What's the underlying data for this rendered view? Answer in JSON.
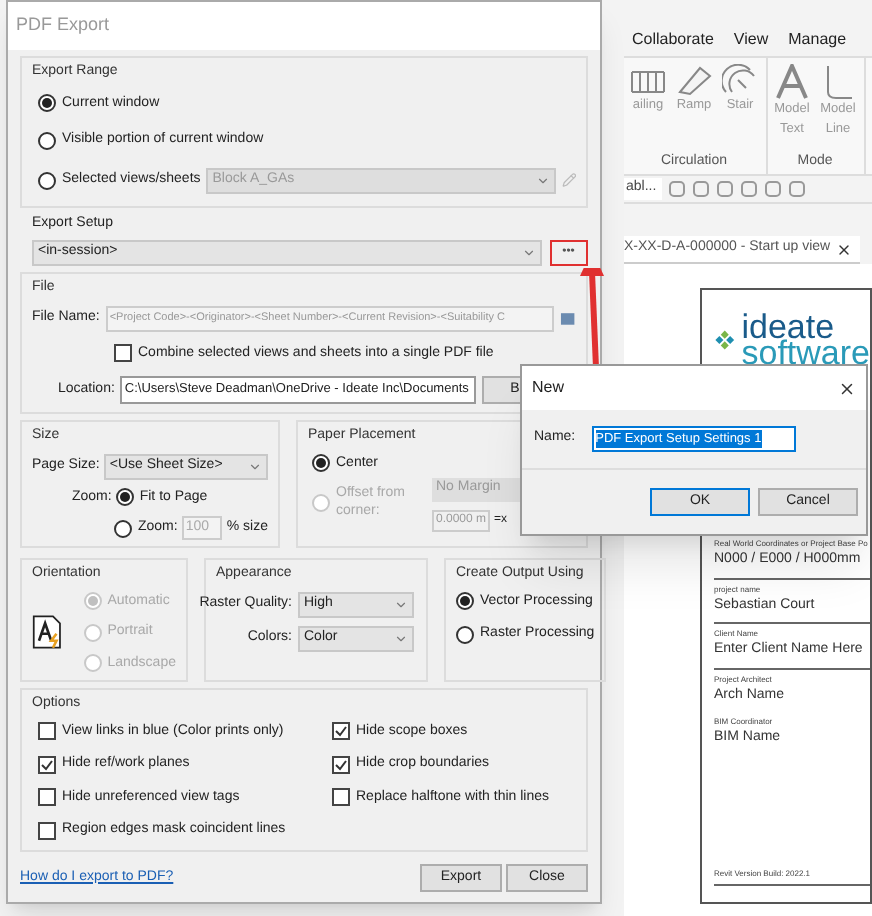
{
  "background": {
    "ribbon_tabs": [
      "Collaborate",
      "View",
      "Manage"
    ],
    "ribbon_groups": [
      {
        "label": "Circulation",
        "buttons": [
          {
            "label": "ailing",
            "kind": "railing"
          },
          {
            "label": "Ramp",
            "kind": "ramp"
          },
          {
            "label": "Stair",
            "kind": "stair"
          }
        ]
      },
      {
        "label": "Mode",
        "buttons": [
          {
            "label": "Model Text",
            "kind": "text"
          },
          {
            "label": "Model Line",
            "kind": "line"
          }
        ]
      }
    ],
    "type_selector": "abl...",
    "view_tab": "X-XX-D-A-000000 - Start up view",
    "sheet": {
      "logo": [
        "ideate",
        "software"
      ],
      "fields": [
        {
          "label": "Real World Coordinates or Project Base Po",
          "value": "N000 / E000 / H000mm"
        },
        {
          "label": "project name",
          "value": "Sebastian Court"
        },
        {
          "label": "Client Name",
          "value": "Enter Client Name Here"
        },
        {
          "label": "Project Architect",
          "value": "Arch Name"
        },
        {
          "label": "BIM Coordinator",
          "value": "BIM Name"
        }
      ],
      "footer": "Revit Version Build: 2022.1"
    }
  },
  "pdf_export": {
    "title": "PDF Export",
    "export_range": {
      "title": "Export Range",
      "options": [
        {
          "label": "Current window",
          "selected": true
        },
        {
          "label": "Visible portion of current window",
          "selected": false
        },
        {
          "label": "Selected views/sheets",
          "selected": false
        }
      ],
      "views_value": "Block A_GAs"
    },
    "export_setup": {
      "title": "Export Setup",
      "value": "<in-session>",
      "more_button": "•••",
      "highlighted": true
    },
    "file": {
      "title": "File",
      "file_name_label": "File Name:",
      "file_name": "<Project Code>-<Originator>-<Sheet Number>-<Current Revision>-<Suitability C",
      "combine": {
        "label": "Combine selected views and sheets into a single PDF file",
        "checked": false
      },
      "location_label": "Location:",
      "location": "C:\\Users\\Steve Deadman\\OneDrive - Ideate Inc\\Documents",
      "browse": "B"
    },
    "size": {
      "title": "Size",
      "page_size_label": "Page Size:",
      "page_size": "<Use Sheet Size>",
      "zoom_label": "Zoom:",
      "zoom_options": [
        {
          "label": "Fit to Page",
          "selected": true
        },
        {
          "label": "Zoom:",
          "selected": false
        }
      ],
      "zoom_value": "100",
      "zoom_unit": "% size"
    },
    "paper_placement": {
      "title": "Paper Placement",
      "options": [
        {
          "label": "Center",
          "selected": true,
          "disabled": false
        },
        {
          "label": "Offset from corner:",
          "selected": false,
          "disabled": true
        }
      ],
      "margin": "No Margin",
      "offset": "0.0000 m",
      "offset_axis": "=x"
    },
    "orientation": {
      "title": "Orientation",
      "options": [
        {
          "label": "Automatic",
          "selected": true,
          "disabled": true
        },
        {
          "label": "Portrait",
          "selected": false,
          "disabled": true
        },
        {
          "label": "Landscape",
          "selected": false,
          "disabled": true
        }
      ]
    },
    "appearance": {
      "title": "Appearance",
      "fields": [
        {
          "label": "Raster Quality:",
          "value": "High"
        },
        {
          "label": "Colors:",
          "value": "Color"
        }
      ]
    },
    "output": {
      "title": "Create Output Using",
      "options": [
        {
          "label": "Vector Processing",
          "selected": true
        },
        {
          "label": "Raster Processing",
          "selected": false
        }
      ]
    },
    "options": {
      "title": "Options",
      "items": [
        {
          "label": "View links in blue (Color prints only)",
          "checked": false
        },
        {
          "label": "Hide scope boxes",
          "checked": true
        },
        {
          "label": "Hide ref/work planes",
          "checked": true
        },
        {
          "label": "Hide crop boundaries",
          "checked": true
        },
        {
          "label": "Hide unreferenced view tags",
          "checked": false
        },
        {
          "label": "Replace halftone with thin lines",
          "checked": false
        },
        {
          "label": "Region edges mask coincident lines",
          "checked": false
        }
      ]
    },
    "help_link": "How do I export to PDF?",
    "buttons": [
      "Export",
      "Close"
    ]
  },
  "new_dialog": {
    "title": "New",
    "name_label": "Name:",
    "name_value": "PDF Export Setup Settings 1",
    "name_selected": true,
    "buttons": [
      {
        "label": "OK",
        "default": true
      },
      {
        "label": "Cancel",
        "default": false
      }
    ]
  }
}
